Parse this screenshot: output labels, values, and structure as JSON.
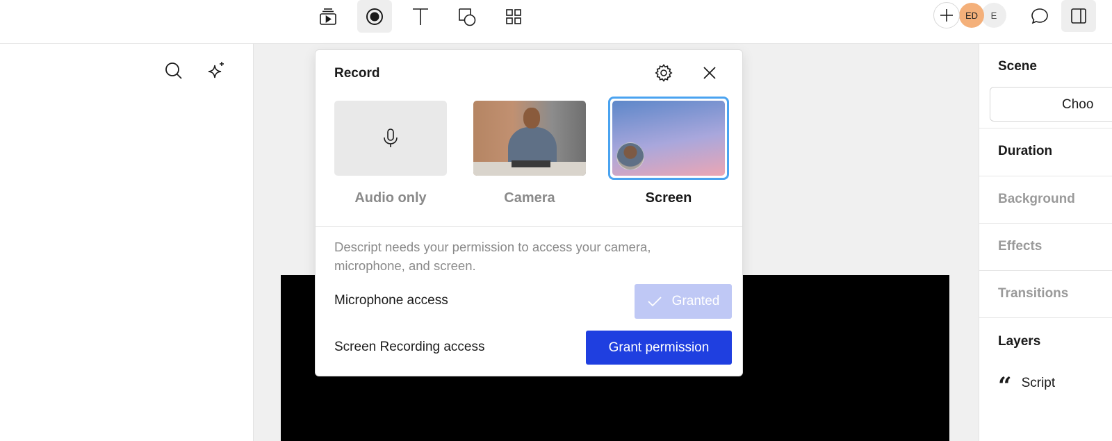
{
  "toolbar": {
    "tools": [
      {
        "name": "media-library-icon"
      },
      {
        "name": "record-icon",
        "active": true
      },
      {
        "name": "text-icon"
      },
      {
        "name": "shapes-icon"
      },
      {
        "name": "elements-grid-icon"
      }
    ],
    "collaborators": [
      {
        "initials": "ED",
        "color": "#f4b07a"
      },
      {
        "initials": "E",
        "color": "#eeeeee"
      }
    ]
  },
  "record_popover": {
    "title": "Record",
    "options": [
      {
        "label": "Audio only",
        "selected": false
      },
      {
        "label": "Camera",
        "selected": false
      },
      {
        "label": "Screen",
        "selected": true
      }
    ],
    "permission_message": "Descript needs your permission to access your camera, microphone, and screen.",
    "microphone": {
      "label": "Microphone access",
      "status_label": "Granted"
    },
    "screen_recording": {
      "label": "Screen Recording access",
      "button_label": "Grant permission"
    }
  },
  "right_panel": {
    "scene_title": "Scene",
    "choose_label": "Choo",
    "duration_title": "Duration",
    "background_title": "Background",
    "effects_title": "Effects",
    "transitions_title": "Transitions",
    "layers_title": "Layers",
    "layers": [
      {
        "label": "Script",
        "icon": "quote-icon"
      }
    ]
  },
  "colors": {
    "accent": "#1f3fe0",
    "granted": "#bfc8f5",
    "selection": "#4aa3f0",
    "collaborator_ed": "#f4b07a"
  }
}
